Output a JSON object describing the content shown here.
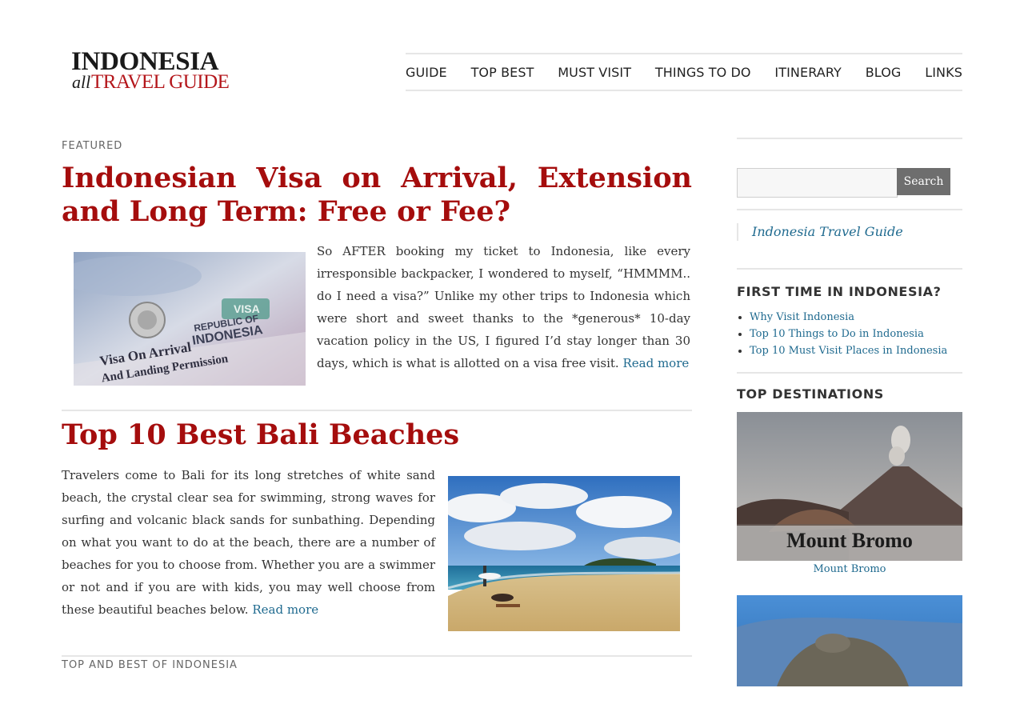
{
  "site": {
    "logo_top": "INDONESIA",
    "logo_all": "all",
    "logo_guide": "TRAVEL GUIDE"
  },
  "nav": {
    "items": [
      "GUIDE",
      "TOP BEST",
      "MUST VISIT",
      "THINGS TO DO",
      "ITINERARY",
      "BLOG",
      "LINKS"
    ]
  },
  "main": {
    "category_featured": "FEATURED",
    "post1": {
      "title": "Indonesian Visa on Arrival, Extension and Long Term: Free or Fee?",
      "excerpt": "So AFTER booking my ticket to Indonesia, like every irresponsible backpacker, I wondered to myself, “HMMMM.. do I need a visa?” Unlike my other trips to Indonesia which were short and sweet thanks to the *generous* 10-day vacation policy in the US, I figured I’d stay longer than 30 days, which is what is allotted on a visa free visit.",
      "read_more": "Read more",
      "image_text": {
        "line1": "REPUBLIC OF",
        "line2": "INDONESIA",
        "line3": "Visa On Arrival",
        "line4": "And Landing Permission",
        "stamp": "VISA"
      }
    },
    "post2": {
      "title": "Top 10 Best Bali Beaches",
      "excerpt": "Travelers come to Bali for its long stretches of white sand beach, the crystal clear sea for swimming, strong waves for surfing and volcanic black sands for sunbathing. Depending on what you want to do at the beach, there are a number of beaches for you to choose from. Whether you are a swimmer or not and if you are with kids, you may well choose from these beautiful beaches below.",
      "read_more": "Read more"
    },
    "category_next": "TOP AND BEST OF INDONESIA"
  },
  "sidebar": {
    "search_button": "Search",
    "search_value": "",
    "guide_link": "Indonesia Travel Guide",
    "first_time_heading": "FIRST TIME IN INDONESIA?",
    "first_time_links": [
      "Why Visit Indonesia",
      "Top 10 Things to Do in Indonesia",
      "Top 10 Must Visit Places in Indonesia"
    ],
    "top_dest_heading": "TOP DESTINATIONS",
    "dest1_overlay": "Mount Bromo",
    "dest1_caption": "Mount Bromo"
  },
  "colors": {
    "title_red": "#a50d0d",
    "link_blue": "#1f6a8f",
    "logo_red": "#b4161b"
  }
}
